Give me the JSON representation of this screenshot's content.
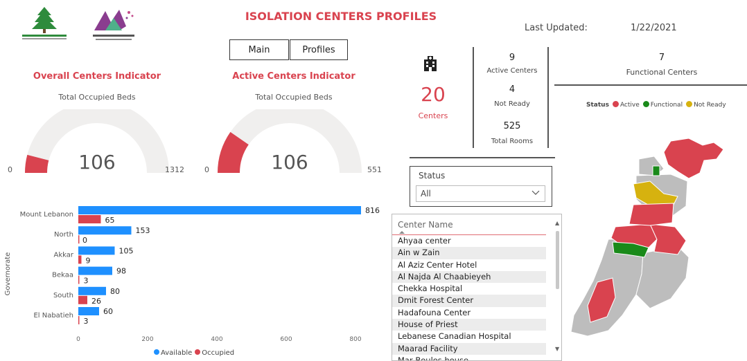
{
  "header": {
    "title": "ISOLATION CENTERS PROFILES",
    "last_updated_label": "Last Updated:",
    "last_updated_value": "1/22/2021",
    "logos": [
      "drm-unit-logo",
      "covid-committee-logo"
    ]
  },
  "nav": {
    "main_label": "Main",
    "profiles_label": "Profiles"
  },
  "gauges": [
    {
      "title": "Overall Centers Indicator",
      "subtitle": "Total Occupied Beds",
      "value": 106,
      "min": 0,
      "max": 1312
    },
    {
      "title": "Active Centers Indicator",
      "subtitle": "Total Occupied Beds",
      "value": 106,
      "min": 0,
      "max": 551
    }
  ],
  "kpis": {
    "icon": "hospital-building-icon",
    "centers_count": "20",
    "centers_label": "Centers",
    "active_count": "9",
    "active_label": "Active Centers",
    "not_ready_count": "4",
    "not_ready_label": "Not Ready",
    "total_rooms_count": "525",
    "total_rooms_label": "Total Rooms",
    "functional_count": "7",
    "functional_label": "Functional Centers"
  },
  "status_legend": {
    "title": "Status",
    "items": [
      {
        "label": "Active",
        "color": "#d9434f"
      },
      {
        "label": "Functional",
        "color": "#1a8a1a"
      },
      {
        "label": "Not Ready",
        "color": "#d6b20f"
      }
    ]
  },
  "status_slicer": {
    "label": "Status",
    "value": "All"
  },
  "center_list": {
    "header": "Center Name",
    "items": [
      "Ahyaa center",
      "Ain w Zain",
      "Al Aziz Center Hotel",
      "Al Najda Al Chaabieyeh",
      "Chekka Hospital",
      "Dmit Forest Center",
      "Hadafouna Center",
      "House of Priest",
      "Lebanese Canadian Hospital",
      "Maarad Facility",
      "Mar Boulos house"
    ]
  },
  "chart_data": {
    "type": "bar",
    "orientation": "horizontal",
    "categories": [
      "Mount Lebanon",
      "North",
      "Akkar",
      "Bekaa",
      "South",
      "El Nabatieh"
    ],
    "series": [
      {
        "name": "Available",
        "values": [
          816,
          153,
          105,
          98,
          80,
          60
        ],
        "color": "#1e90ff"
      },
      {
        "name": "Occupied",
        "values": [
          65,
          0,
          9,
          3,
          26,
          3
        ],
        "color": "#d9434f"
      }
    ],
    "ylabel": "Governorate",
    "xlim": [
      0,
      816
    ],
    "xticks": [
      0,
      200,
      400,
      600,
      800
    ],
    "legend_position": "bottom"
  },
  "map": {
    "regions": [
      {
        "name": "akkar",
        "status": "Active"
      },
      {
        "name": "north-coast",
        "status": "Functional"
      },
      {
        "name": "north-central",
        "status": "Not Ready"
      },
      {
        "name": "mount-lebanon-north",
        "status": "Active"
      },
      {
        "name": "mount-lebanon-central",
        "status": "Functional"
      },
      {
        "name": "bekaa",
        "status": "Active"
      },
      {
        "name": "south",
        "status": "Active"
      }
    ],
    "colors": {
      "active": "#d9434f",
      "functional": "#1a8a1a",
      "not_ready": "#d6b20f",
      "none": "#bdbdbd"
    }
  }
}
